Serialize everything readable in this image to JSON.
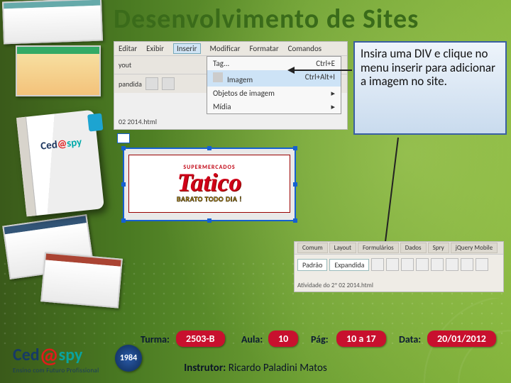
{
  "title": "Desenvolvimento de Sites",
  "callout": "Insira uma DIV e clique no menu inserir para adicionar a imagem no site.",
  "dw_menu": {
    "menubar": [
      "Editar",
      "Exibir",
      "Inserir",
      "Modificar",
      "Formatar",
      "Comandos"
    ],
    "selected_menu": "Inserir",
    "toolbar_labels": [
      "yout",
      "pandida"
    ],
    "dropdown": [
      {
        "label": "Tag...",
        "shortcut": "Ctrl+E"
      },
      {
        "label": "Imagem",
        "shortcut": "Ctrl+Alt+I"
      },
      {
        "label": "Objetos de imagem",
        "shortcut": ""
      },
      {
        "label": "Mídia",
        "shortcut": ""
      }
    ],
    "highlighted": "Imagem",
    "open_file": "02 2014.html"
  },
  "selected_image": {
    "supermarket_label": "SUPERMERCADOS",
    "brand": "Tatico",
    "slogan": "BARATO TODO DIA !"
  },
  "insert_panel": {
    "tabs": [
      "Comum",
      "Layout",
      "Formulários",
      "Dados",
      "Spry",
      "jQuery Mobile"
    ],
    "mode_left": "Padrão",
    "mode_right": "Expandida",
    "file_label": "Atividade do 2º 02 2014.html"
  },
  "footer": {
    "turma_label": "Turma:",
    "turma_value": "2503-B",
    "aula_label": "Aula:",
    "aula_value": "10",
    "pag_label": "Pág:",
    "pag_value": "10 a 17",
    "data_label": "Data:",
    "data_value": "20/01/2012"
  },
  "instructor": {
    "label": "Instrutor:",
    "name": "Ricardo Paladini Matos"
  },
  "brand": {
    "name_ced": "Ced",
    "name_spy": "spy",
    "year": "1984",
    "tagline": "Ensino com Futuro Profissional"
  }
}
